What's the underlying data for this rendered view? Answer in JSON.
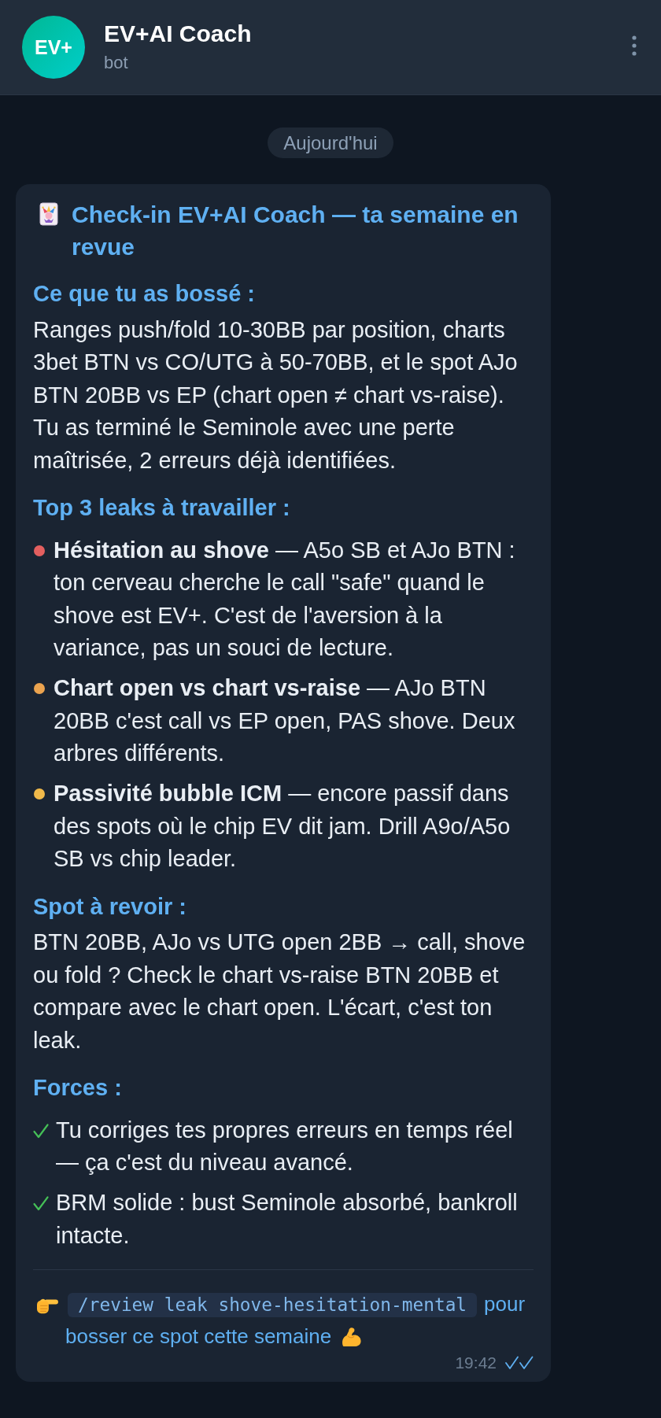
{
  "chat": {
    "avatar_text": "EV+",
    "name": "EV+AI Coach",
    "status": "bot"
  },
  "date_separator": "Aujourd'hui",
  "message": {
    "title": "Check-in EV+AI Coach — ta semaine en revue",
    "sections": [
      {
        "kind": "paragraph",
        "heading": "Ce que tu as bossé :",
        "text": "Ranges push/fold 10-30BB par position, charts 3bet BTN vs CO/UTG à 50-70BB, et le spot AJo BTN 20BB vs EP (chart open ≠ chart vs-raise). Tu as terminé le Seminole avec une perte maîtrisée, 2 erreurs déjà identifiées."
      },
      {
        "kind": "bullets",
        "heading": "Top 3 leaks à travailler :",
        "items": [
          {
            "text": "**Hésitation au shove** — A5o SB et AJo BTN : ton cerveau cherche le call \"safe\" quand le shove est EV+. C'est de l'aversion à la variance, pas un souci de lecture.",
            "color": "#e35f5f"
          },
          {
            "text": "**Chart open vs chart vs-raise** — AJo BTN 20BB c'est call vs EP open, PAS shove. Deux arbres différents.",
            "color": "#eba34f"
          },
          {
            "text": "**Passivité bubble ICM** — encore passif dans des spots où le chip EV dit jam. Drill A9o/A5o SB vs chip leader.",
            "color": "#f0b94a"
          }
        ]
      },
      {
        "kind": "paragraph",
        "heading": "Spot à revoir :",
        "text": "BTN 20BB, AJo vs UTG open 2BB → call, shove ou fold ? Check le chart vs-raise BTN 20BB et compare avec le chart open. L'écart, c'est ton leak."
      },
      {
        "kind": "checks",
        "heading": "Forces :",
        "items": [
          {
            "text": "Tu corriges tes propres erreurs en temps réel — ça c'est du niveau avancé."
          },
          {
            "text": "BRM solide : bust Seminole absorbé, bankroll intacte."
          }
        ]
      }
    ],
    "footer": {
      "command": "/review leak shove-hesitation-mental",
      "text": "pour bosser ce spot cette semaine"
    },
    "time": "19:42",
    "read": true
  }
}
